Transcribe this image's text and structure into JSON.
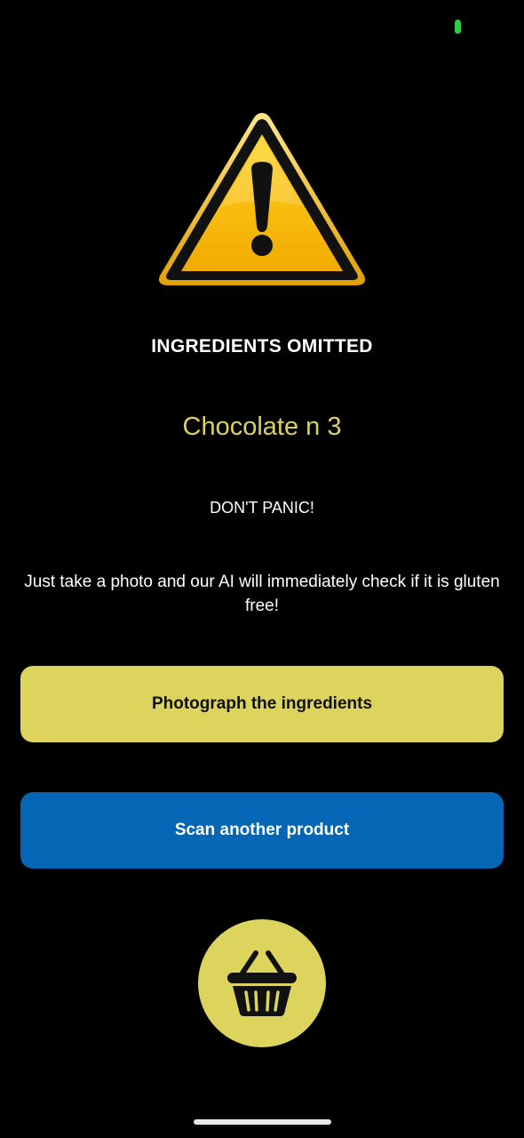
{
  "status_bar": {
    "indicator_color": "#2ecc40"
  },
  "warning": {
    "icon": "warning-triangle-icon"
  },
  "screen": {
    "title": "INGREDIENTS OMITTED",
    "product_name": "Chocolate n 3",
    "panic_text": "DON'T PANIC!",
    "explanation": "Just take a photo and our AI will immediately check if it is gluten free!"
  },
  "actions": {
    "photograph_label": "Photograph the ingredients",
    "scan_label": "Scan another product",
    "basket_icon": "shopping-basket-icon"
  },
  "colors": {
    "accent_yellow": "#dcd45c",
    "product_name_color": "#d9d261",
    "primary_blue": "#0466b4",
    "background": "#000000"
  }
}
